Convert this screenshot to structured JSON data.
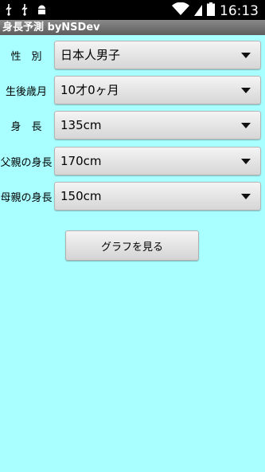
{
  "status": {
    "time": "16:13",
    "icons": [
      "usb-icon",
      "usb-icon",
      "android-icon",
      "wifi-icon",
      "battery-icon"
    ]
  },
  "app": {
    "title": "身長予測 byNSDev"
  },
  "form": [
    {
      "label": "性　別",
      "value": "日本人男子"
    },
    {
      "label": "生後歳月",
      "value": "10才0ヶ月"
    },
    {
      "label": "身　長",
      "value": "135cm"
    },
    {
      "label": "父親の身長",
      "value": "170cm"
    },
    {
      "label": "母親の身長",
      "value": "150cm"
    }
  ],
  "button": {
    "label": "グラフを見る"
  }
}
